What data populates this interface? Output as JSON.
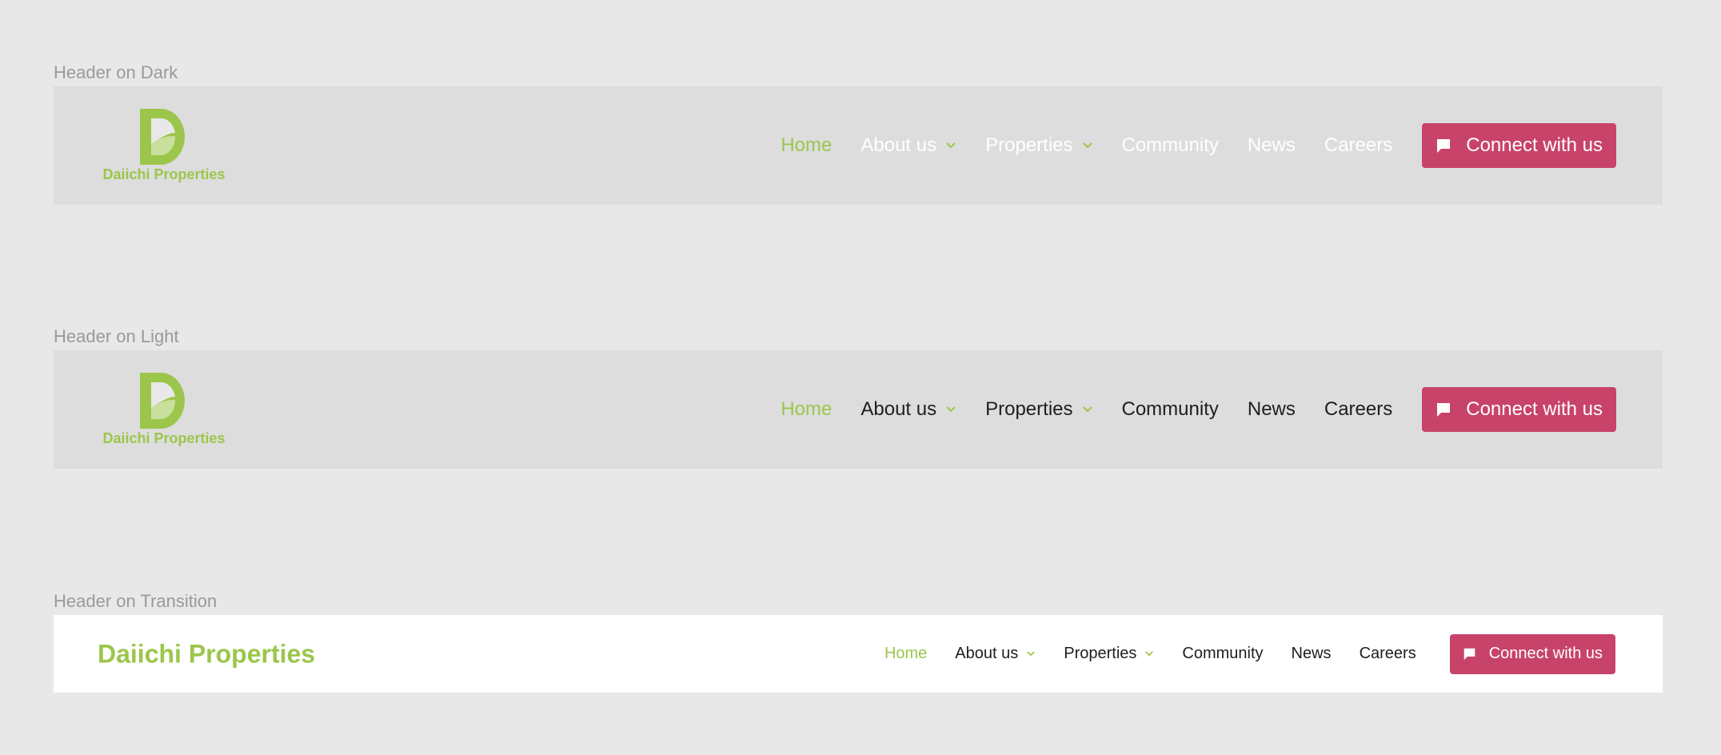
{
  "brand": {
    "name": "Daiichi Properties",
    "green": "#9cc64b",
    "accent": "#c8436a"
  },
  "sections": [
    {
      "label": "Header on Dark",
      "theme": "dark"
    },
    {
      "label": "Header on Light",
      "theme": "light"
    },
    {
      "label": "Header on Transition",
      "theme": "transition"
    }
  ],
  "nav": {
    "items": [
      {
        "label": "Home",
        "active": true,
        "dropdown": false
      },
      {
        "label": "About us",
        "active": false,
        "dropdown": true
      },
      {
        "label": "Properties",
        "active": false,
        "dropdown": true
      },
      {
        "label": "Community",
        "active": false,
        "dropdown": false
      },
      {
        "label": "News",
        "active": false,
        "dropdown": false
      },
      {
        "label": "Careers",
        "active": false,
        "dropdown": false
      }
    ],
    "cta": {
      "label": "Connect with us",
      "icon": "chat-bubble-icon"
    }
  },
  "icons": {
    "logo": "daiichi-logo-icon",
    "chevron": "chevron-down-icon"
  }
}
